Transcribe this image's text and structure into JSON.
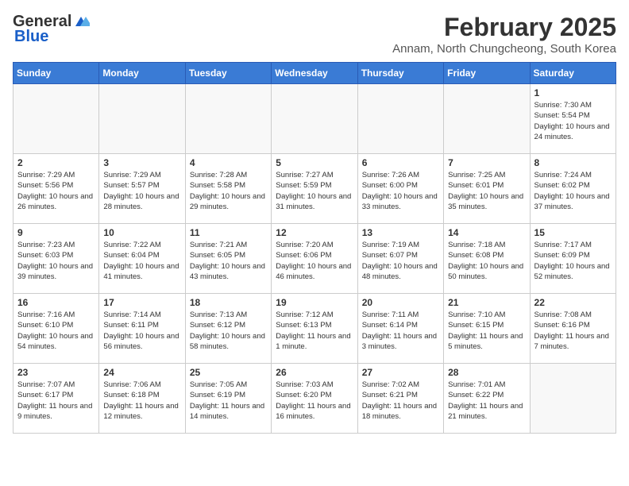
{
  "header": {
    "logo_general": "General",
    "logo_blue": "Blue",
    "month_year": "February 2025",
    "location": "Annam, North Chungcheong, South Korea"
  },
  "weekdays": [
    "Sunday",
    "Monday",
    "Tuesday",
    "Wednesday",
    "Thursday",
    "Friday",
    "Saturday"
  ],
  "weeks": [
    [
      {
        "day": "",
        "info": ""
      },
      {
        "day": "",
        "info": ""
      },
      {
        "day": "",
        "info": ""
      },
      {
        "day": "",
        "info": ""
      },
      {
        "day": "",
        "info": ""
      },
      {
        "day": "",
        "info": ""
      },
      {
        "day": "1",
        "info": "Sunrise: 7:30 AM\nSunset: 5:54 PM\nDaylight: 10 hours and 24 minutes."
      }
    ],
    [
      {
        "day": "2",
        "info": "Sunrise: 7:29 AM\nSunset: 5:56 PM\nDaylight: 10 hours and 26 minutes."
      },
      {
        "day": "3",
        "info": "Sunrise: 7:29 AM\nSunset: 5:57 PM\nDaylight: 10 hours and 28 minutes."
      },
      {
        "day": "4",
        "info": "Sunrise: 7:28 AM\nSunset: 5:58 PM\nDaylight: 10 hours and 29 minutes."
      },
      {
        "day": "5",
        "info": "Sunrise: 7:27 AM\nSunset: 5:59 PM\nDaylight: 10 hours and 31 minutes."
      },
      {
        "day": "6",
        "info": "Sunrise: 7:26 AM\nSunset: 6:00 PM\nDaylight: 10 hours and 33 minutes."
      },
      {
        "day": "7",
        "info": "Sunrise: 7:25 AM\nSunset: 6:01 PM\nDaylight: 10 hours and 35 minutes."
      },
      {
        "day": "8",
        "info": "Sunrise: 7:24 AM\nSunset: 6:02 PM\nDaylight: 10 hours and 37 minutes."
      }
    ],
    [
      {
        "day": "9",
        "info": "Sunrise: 7:23 AM\nSunset: 6:03 PM\nDaylight: 10 hours and 39 minutes."
      },
      {
        "day": "10",
        "info": "Sunrise: 7:22 AM\nSunset: 6:04 PM\nDaylight: 10 hours and 41 minutes."
      },
      {
        "day": "11",
        "info": "Sunrise: 7:21 AM\nSunset: 6:05 PM\nDaylight: 10 hours and 43 minutes."
      },
      {
        "day": "12",
        "info": "Sunrise: 7:20 AM\nSunset: 6:06 PM\nDaylight: 10 hours and 46 minutes."
      },
      {
        "day": "13",
        "info": "Sunrise: 7:19 AM\nSunset: 6:07 PM\nDaylight: 10 hours and 48 minutes."
      },
      {
        "day": "14",
        "info": "Sunrise: 7:18 AM\nSunset: 6:08 PM\nDaylight: 10 hours and 50 minutes."
      },
      {
        "day": "15",
        "info": "Sunrise: 7:17 AM\nSunset: 6:09 PM\nDaylight: 10 hours and 52 minutes."
      }
    ],
    [
      {
        "day": "16",
        "info": "Sunrise: 7:16 AM\nSunset: 6:10 PM\nDaylight: 10 hours and 54 minutes."
      },
      {
        "day": "17",
        "info": "Sunrise: 7:14 AM\nSunset: 6:11 PM\nDaylight: 10 hours and 56 minutes."
      },
      {
        "day": "18",
        "info": "Sunrise: 7:13 AM\nSunset: 6:12 PM\nDaylight: 10 hours and 58 minutes."
      },
      {
        "day": "19",
        "info": "Sunrise: 7:12 AM\nSunset: 6:13 PM\nDaylight: 11 hours and 1 minute."
      },
      {
        "day": "20",
        "info": "Sunrise: 7:11 AM\nSunset: 6:14 PM\nDaylight: 11 hours and 3 minutes."
      },
      {
        "day": "21",
        "info": "Sunrise: 7:10 AM\nSunset: 6:15 PM\nDaylight: 11 hours and 5 minutes."
      },
      {
        "day": "22",
        "info": "Sunrise: 7:08 AM\nSunset: 6:16 PM\nDaylight: 11 hours and 7 minutes."
      }
    ],
    [
      {
        "day": "23",
        "info": "Sunrise: 7:07 AM\nSunset: 6:17 PM\nDaylight: 11 hours and 9 minutes."
      },
      {
        "day": "24",
        "info": "Sunrise: 7:06 AM\nSunset: 6:18 PM\nDaylight: 11 hours and 12 minutes."
      },
      {
        "day": "25",
        "info": "Sunrise: 7:05 AM\nSunset: 6:19 PM\nDaylight: 11 hours and 14 minutes."
      },
      {
        "day": "26",
        "info": "Sunrise: 7:03 AM\nSunset: 6:20 PM\nDaylight: 11 hours and 16 minutes."
      },
      {
        "day": "27",
        "info": "Sunrise: 7:02 AM\nSunset: 6:21 PM\nDaylight: 11 hours and 18 minutes."
      },
      {
        "day": "28",
        "info": "Sunrise: 7:01 AM\nSunset: 6:22 PM\nDaylight: 11 hours and 21 minutes."
      },
      {
        "day": "",
        "info": ""
      }
    ]
  ]
}
